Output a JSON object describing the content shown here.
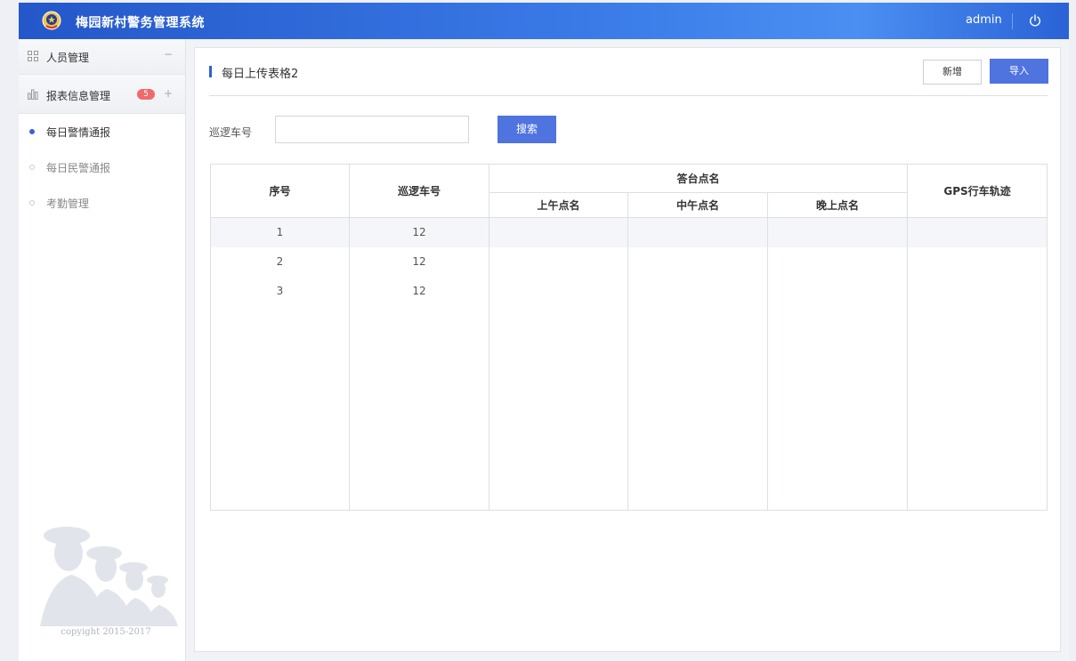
{
  "header": {
    "title": "梅园新村警务管理系统",
    "username": "admin",
    "emblem_icon": "police-emblem-icon",
    "power_icon": "power-icon"
  },
  "sidebar": {
    "groups": [
      {
        "label": "人员管理",
        "icon": "grid-icon",
        "toggle": "−",
        "expanded": true
      },
      {
        "label": "报表信息管理",
        "icon": "bar-chart-icon",
        "toggle": "+",
        "badge": "5"
      }
    ],
    "items": [
      {
        "label": "每日警情通报",
        "active": true
      },
      {
        "label": "每日民警通报",
        "active": false
      },
      {
        "label": "考勤管理",
        "active": false
      }
    ],
    "copyright": "copyight 2015-2017"
  },
  "page": {
    "title": "每日上传表格2",
    "new_button": "新增",
    "import_button": "导入"
  },
  "search": {
    "label": "巡逻车号",
    "value": "",
    "placeholder": "",
    "button": "搜索"
  },
  "table": {
    "headers": {
      "index": "序号",
      "car": "巡逻车号",
      "roll_call": "答台点名",
      "morning": "上午点名",
      "noon": "中午点名",
      "evening": "晚上点名",
      "gps": "GPS行车轨迹"
    },
    "rows": [
      {
        "index": "1",
        "car": "12",
        "morning": "",
        "noon": "",
        "evening": "",
        "gps": ""
      },
      {
        "index": "2",
        "car": "12",
        "morning": "",
        "noon": "",
        "evening": "",
        "gps": ""
      },
      {
        "index": "3",
        "car": "12",
        "morning": "",
        "noon": "",
        "evening": "",
        "gps": ""
      }
    ]
  },
  "colors": {
    "brand": "#2f5fd0",
    "button": "#4f73df",
    "badge": "#ef6a6a"
  }
}
